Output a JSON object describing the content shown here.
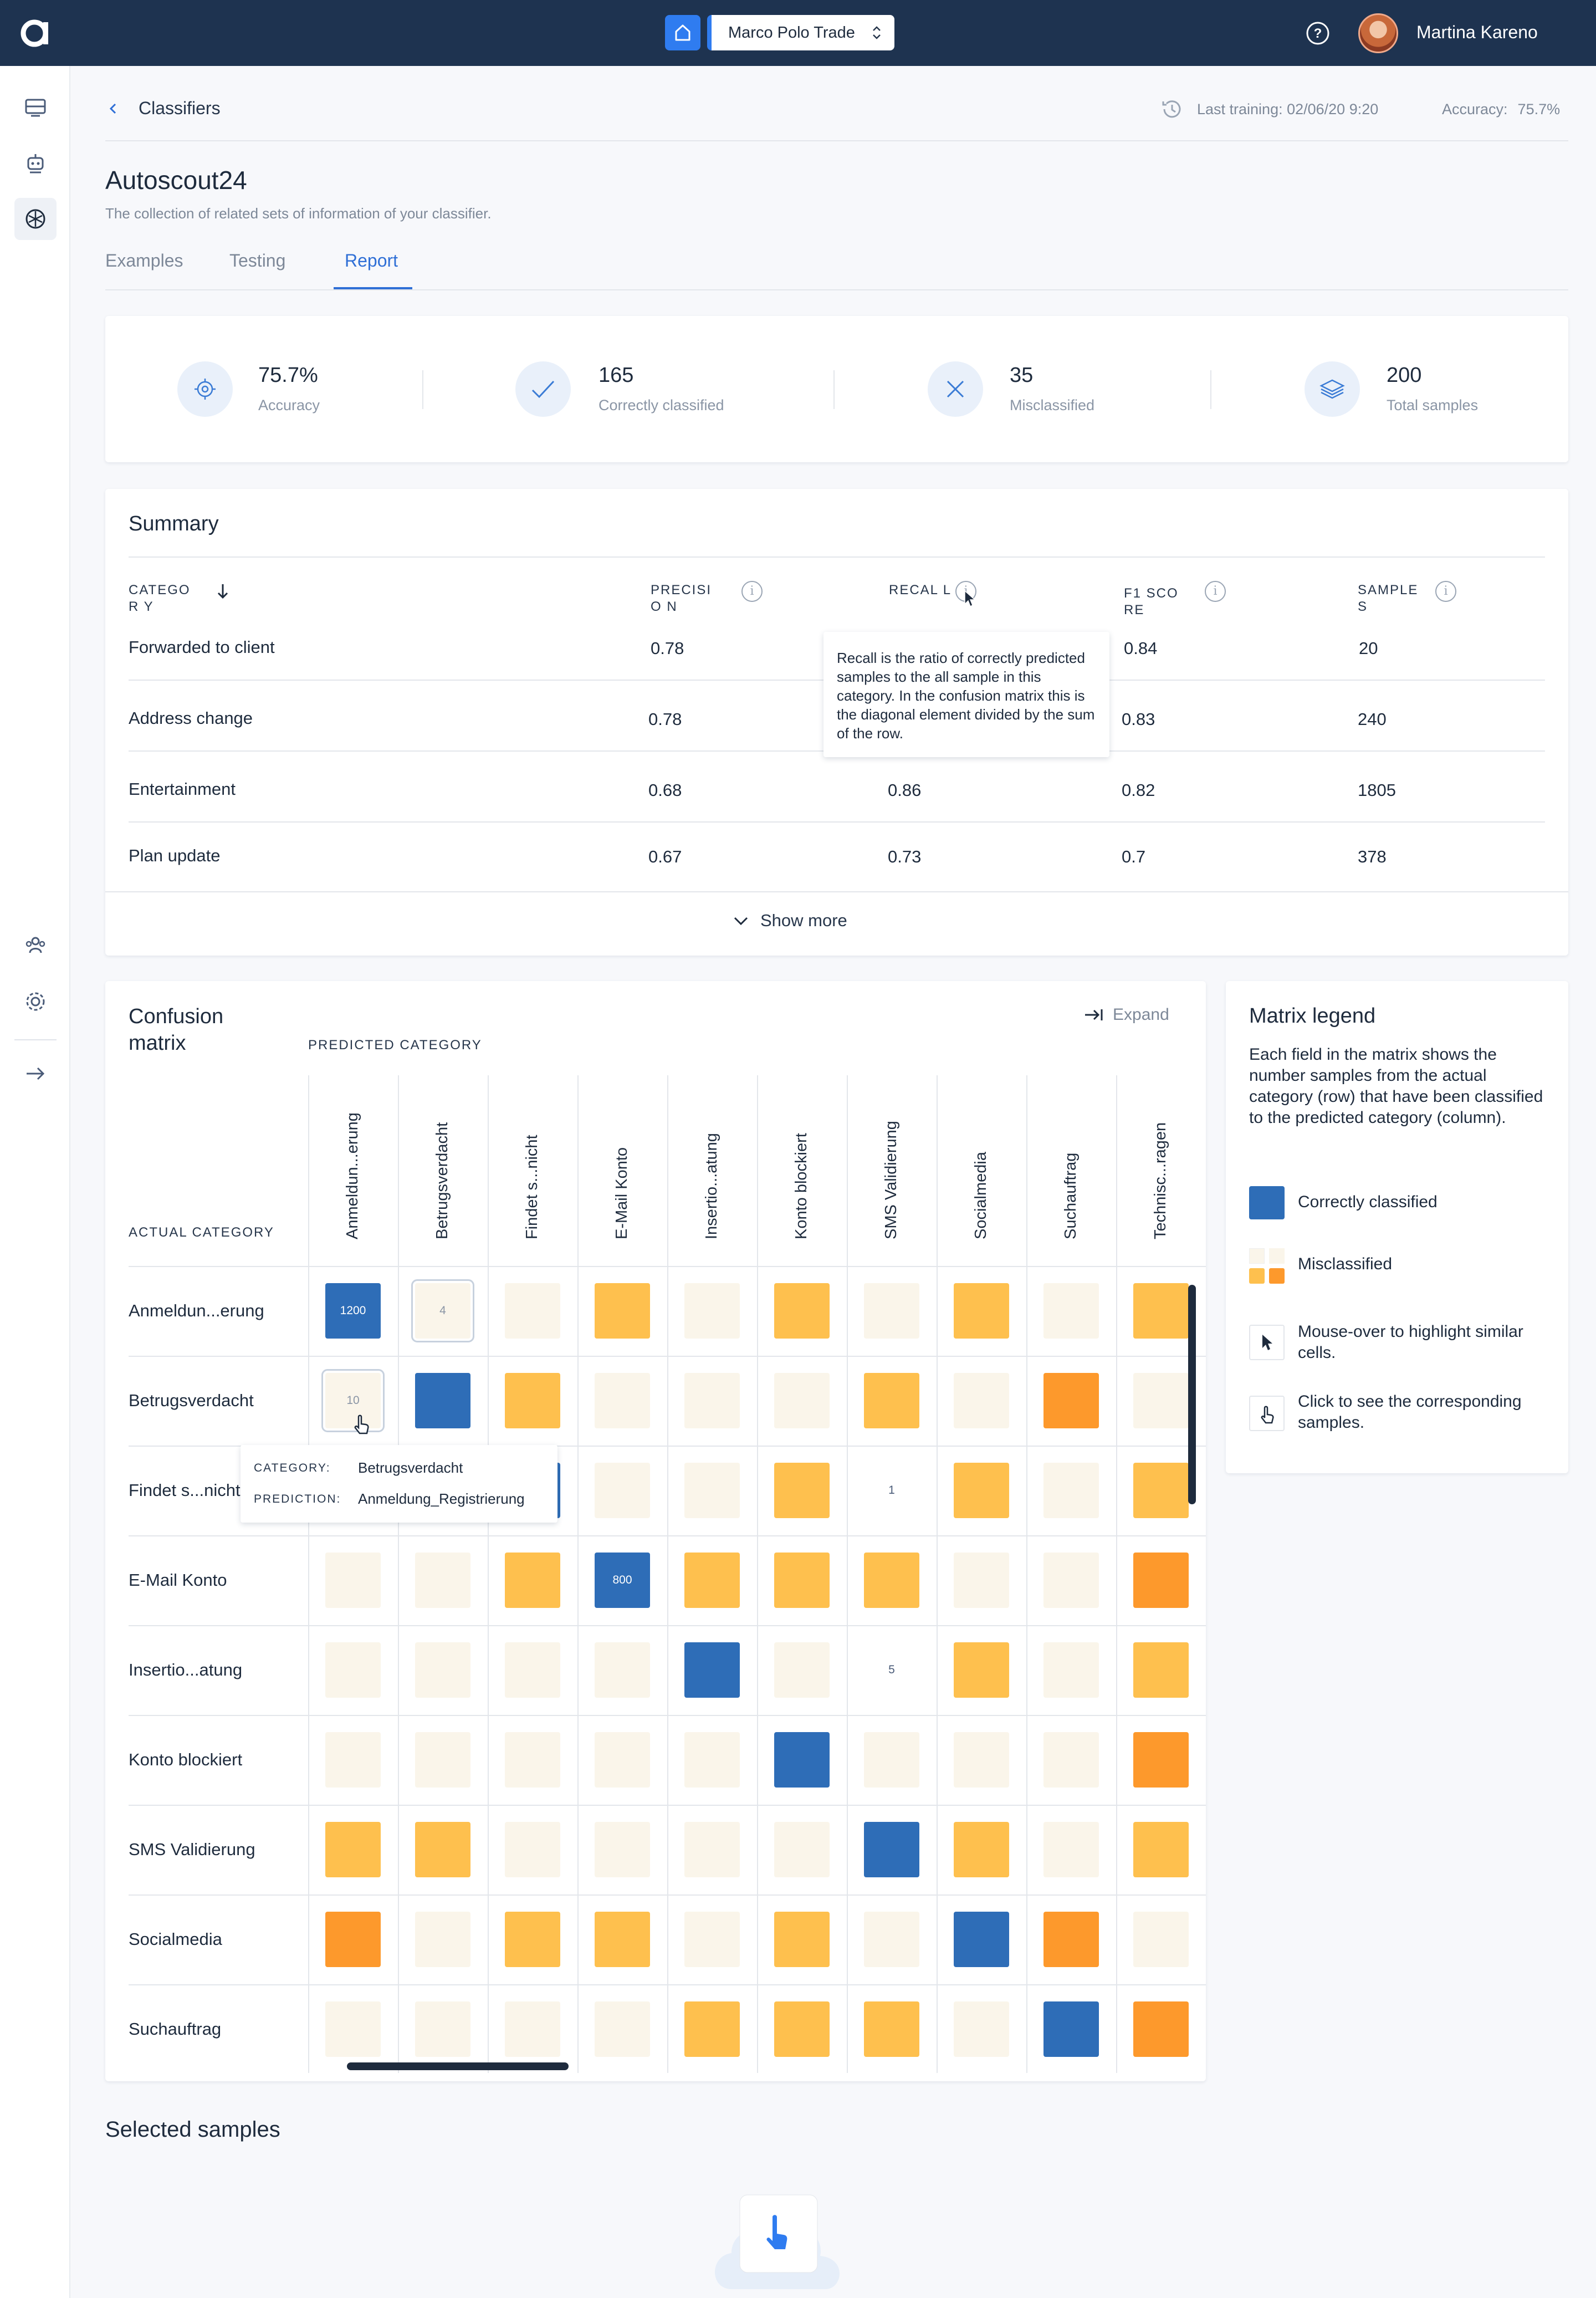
{
  "topbar": {
    "org_name": "Marco Polo Trade",
    "user_name": "Martina Kareno"
  },
  "header": {
    "breadcrumb": "Classifiers",
    "last_training": "Last training: 02/06/20 9:20",
    "accuracy_label": "Accuracy:",
    "accuracy_value": "75.7%"
  },
  "page": {
    "title": "Autoscout24",
    "subtitle": "The collection of related sets of information of your classifier.",
    "tabs": [
      "Examples",
      "Testing",
      "Report"
    ],
    "active_tab": "Report"
  },
  "stats": [
    {
      "icon": "target-icon",
      "value": "75.7%",
      "label": "Accuracy"
    },
    {
      "icon": "check-icon",
      "value": "165",
      "label": "Correctly classified"
    },
    {
      "icon": "cross-icon",
      "value": "35",
      "label": "Misclassified"
    },
    {
      "icon": "layers-icon",
      "value": "200",
      "label": "Total samples"
    }
  ],
  "summary": {
    "title": "Summary",
    "columns": [
      "CATEGOR Y",
      "PRECISIO N",
      "RECAL L",
      "F1 SCORE",
      "SAMPLE S"
    ],
    "rows": [
      [
        "Forwarded to client",
        "0.78",
        "",
        "0.84",
        "20"
      ],
      [
        "Address change",
        "0.78",
        "",
        "0.83",
        "240"
      ],
      [
        "Entertainment",
        "0.68",
        "0.86",
        "0.82",
        "1805"
      ],
      [
        "Plan update",
        "0.67",
        "0.73",
        "0.7",
        "378"
      ]
    ],
    "recall_tooltip": "Recall is the ratio of correctly predicted samples to the all sample in this category. In the confusion matrix this is the diagonal element divided by the sum of the row.",
    "show_more": "Show more"
  },
  "confusion_matrix": {
    "title": "Confusion matrix",
    "predicted_label": "PREDICTED CATEGORY",
    "actual_label": "ACTUAL CATEGORY",
    "expand_label": "Expand",
    "columns": [
      "Anmeldun...erung",
      "Betrugsverdacht",
      "Findet s...nicht",
      "E-Mail Konto",
      "Insertio...atung",
      "Konto blockiert",
      "SMS Validierung",
      "Socialmedia",
      "Suchauftrag",
      "Technisc...ragen"
    ],
    "rows": [
      "Anmeldun...erung",
      "Betrugsverdacht",
      "Findet s...nicht",
      "E-Mail Konto",
      "Insertio...atung",
      "Konto blockiert",
      "SMS Validierung",
      "Socialmedia",
      "Suchauftrag"
    ],
    "cells": [
      [
        "C:1200",
        "H:4",
        "L",
        "M",
        "L",
        "M",
        "L",
        "M",
        "L",
        "M"
      ],
      [
        "H:10",
        "C",
        "M",
        "L",
        "L",
        "L",
        "M",
        "L",
        "O",
        "L"
      ],
      [
        "L",
        "L",
        "C",
        "L",
        "L",
        "M",
        "W:1",
        "M",
        "L",
        "M"
      ],
      [
        "L",
        "L",
        "M",
        "C:800",
        "M",
        "M",
        "M",
        "L",
        "L",
        "O"
      ],
      [
        "L",
        "L",
        "L",
        "L",
        "C",
        "L",
        "W:5",
        "M",
        "L",
        "M"
      ],
      [
        "L",
        "L",
        "L",
        "L",
        "L",
        "C",
        "L",
        "L",
        "L",
        "O"
      ],
      [
        "M",
        "M",
        "L",
        "L",
        "L",
        "L",
        "C",
        "M",
        "L",
        "M"
      ],
      [
        "O",
        "L",
        "M",
        "M",
        "L",
        "M",
        "L",
        "C",
        "O",
        "L"
      ],
      [
        "L",
        "L",
        "L",
        "L",
        "M",
        "M",
        "M",
        "L",
        "C",
        "O"
      ]
    ],
    "tooltip": {
      "category_key": "CATEGORY:",
      "category_value": "Betrugsverdacht",
      "prediction_key": "PREDICTION:",
      "prediction_value": "Anmeldung_Registrierung"
    }
  },
  "legend": {
    "title": "Matrix legend",
    "description": "Each field in the matrix shows the number samples from the actual category (row) that have been classified to the predicted category (column).",
    "correct": "Correctly classified",
    "misclassified": "Misclassified",
    "mouseover": "Mouse-over to highlight similar cells.",
    "click": "Click to see the corresponding samples."
  },
  "selected_samples": {
    "title": "Selected samples"
  },
  "colors": {
    "correct": "#2e6db7",
    "light": "#faf5ea",
    "mid": "#fec04e",
    "high": "#fd992c",
    "accent": "#2f6fd6",
    "topbar": "#1e3350"
  }
}
